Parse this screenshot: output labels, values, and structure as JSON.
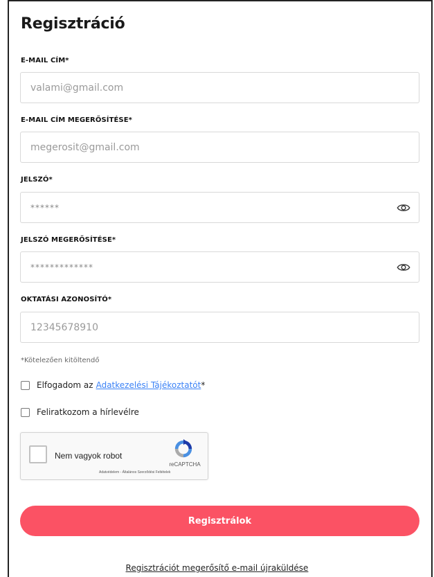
{
  "form": {
    "title": "Regisztráció",
    "email": {
      "label": "E-MAIL CÍM*",
      "placeholder": "valami@gmail.com"
    },
    "email_confirm": {
      "label": "E-MAIL CÍM MEGERŐSÍTÉSE*",
      "placeholder": "megerosit@gmail.com"
    },
    "password": {
      "label": "JELSZÓ*",
      "value": "******"
    },
    "password_confirm": {
      "label": "JELSZÓ MEGERŐSÍTÉSE*",
      "value": "*************"
    },
    "edu_id": {
      "label": "OKTATÁSI AZONOSÍTÓ*",
      "placeholder": "12345678910"
    },
    "required_note": "*Kötelezően kitöltendő",
    "privacy": {
      "prefix": "Elfogadom az",
      "link": "Adatkezelési Tájékoztatót",
      "suffix": "*"
    },
    "newsletter": "Feliratkozom a hírlevélre",
    "submit": "Regisztrálok",
    "resend_link": "Regisztrációt megerősítő e-mail újraküldése"
  },
  "captcha": {
    "label": "Nem vagyok robot",
    "brand": "reCAPTCHA",
    "terms": "Adatvédelem - Általános Szerződési Feltételek"
  },
  "colors": {
    "accent": "#fb5264",
    "link": "#3b82f6"
  },
  "icons": {
    "password_toggle": "eye-icon",
    "captcha_logo": "recaptcha-logo-icon"
  }
}
